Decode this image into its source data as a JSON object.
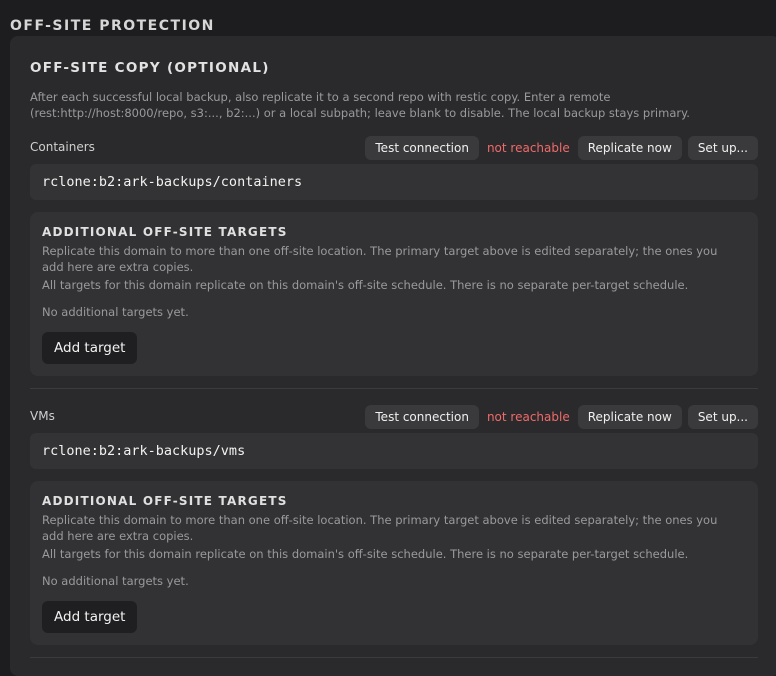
{
  "section_title": "OFF-SITE PROTECTION",
  "panel": {
    "heading": "OFF-SITE COPY (OPTIONAL)",
    "description": "After each successful local backup, also replicate it to a second repo with restic copy. Enter a remote (rest:http://host:8000/repo, s3:..., b2:...) or a local subpath; leave blank to disable. The local backup stays primary."
  },
  "domains": [
    {
      "label": "Containers",
      "test_button": "Test connection",
      "status": "not reachable",
      "replicate_button": "Replicate now",
      "setup_button": "Set up...",
      "remote_value": "rclone:b2:ark-backups/containers",
      "targets": {
        "title": "ADDITIONAL OFF-SITE TARGETS",
        "description": "Replicate this domain to more than one off-site location. The primary target above is edited separately; the ones you add here are extra copies.",
        "schedule_note": "All targets for this domain replicate on this domain's off-site schedule. There is no separate per-target schedule.",
        "empty_text": "No additional targets yet.",
        "add_button": "Add target"
      }
    },
    {
      "label": "VMs",
      "test_button": "Test connection",
      "status": "not reachable",
      "replicate_button": "Replicate now",
      "setup_button": "Set up...",
      "remote_value": "rclone:b2:ark-backups/vms",
      "targets": {
        "title": "ADDITIONAL OFF-SITE TARGETS",
        "description": "Replicate this domain to more than one off-site location. The primary target above is edited separately; the ones you add here are extra copies.",
        "schedule_note": "All targets for this domain replicate on this domain's off-site schedule. There is no separate per-target schedule.",
        "empty_text": "No additional targets yet.",
        "add_button": "Add target"
      }
    }
  ],
  "colors": {
    "background": "#1d1d1f",
    "panel": "#2a2a2c",
    "status_error": "#f06a6a"
  }
}
